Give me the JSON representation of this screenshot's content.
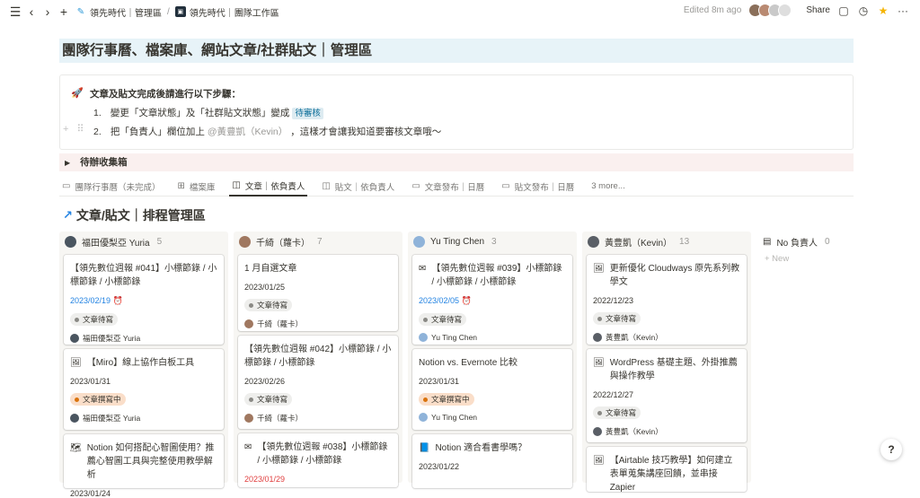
{
  "topbar": {
    "breadcrumb": [
      {
        "label": "領先時代｜管理區",
        "icon": "feather-icon"
      },
      {
        "label": "領先時代｜團隊工作區",
        "icon": "workspace-logo-icon"
      }
    ],
    "edited": "Edited 8m ago",
    "share": "Share",
    "colors": {
      "avatar1": "#8a6f5a",
      "avatar2": "#b98a72",
      "avatar3": "#c9c9c9",
      "avatar4": "#dedede"
    }
  },
  "page": {
    "title": "團隊行事曆、檔案庫、網站文章/社群貼文｜管理區"
  },
  "callout": {
    "icon": "🚀",
    "heading": "文章及貼文完成後請進行以下步驟：",
    "step1_num": "1.",
    "step1_text": "變更「文章狀態」及「社群貼文狀態」變成",
    "step1_tag": "待審核",
    "step2_num": "2.",
    "step2_text": "把「負責人」欄位加上",
    "step2_mention": "@黃豊凱（Kevin）",
    "step2_tail": "，這樣才會讓我知道要審核文章哦～"
  },
  "toggle": {
    "label": "待辦收集箱"
  },
  "tabs": [
    {
      "label": "團隊行事曆（未完成）",
      "icon": "calendar-icon",
      "glyph": "▭"
    },
    {
      "label": "檔案庫",
      "icon": "table-icon",
      "glyph": "⊞"
    },
    {
      "label": "文章｜依負責人",
      "icon": "board-icon",
      "glyph": "◫"
    },
    {
      "label": "貼文｜依負責人",
      "icon": "board-icon",
      "glyph": "◫"
    },
    {
      "label": "文章發布｜日曆",
      "icon": "calendar-icon",
      "glyph": "▭"
    },
    {
      "label": "貼文發布｜日曆",
      "icon": "calendar-icon",
      "glyph": "▭"
    },
    {
      "label": "3 more...",
      "icon": "",
      "glyph": ""
    }
  ],
  "board": {
    "title": "文章/貼文｜排程管理區",
    "columns": [
      {
        "name": "福田優梨亞 Yuria",
        "count": "5",
        "avatar_color": "#4a5560",
        "cards": [
          {
            "title": "【領先數位週報 #041】小標節錄 / 小標節錄 / 小標節錄",
            "date": "2023/02/19",
            "status": "文章待寫",
            "owner": "福田優梨亞 Yuria"
          },
          {
            "title": "【Miro】線上協作白板工具",
            "date": "2023/01/31",
            "status": "文章撰寫中",
            "owner": "福田優梨亞 Yuria"
          },
          {
            "title": "Notion 如何搭配心智圖使用？推薦心智圖工具與完整使用教學解析",
            "date": "2023/01/24"
          }
        ]
      },
      {
        "name": "千綺（蘿卡）",
        "count": "7",
        "avatar_color": "#a07860",
        "cards": [
          {
            "title": "1 月自選文章",
            "date": "2023/01/25",
            "status": "文章待寫",
            "owner": "千綺（蘿卡）"
          },
          {
            "title": "【領先數位週報 #042】小標節錄 / 小標節錄 / 小標節錄",
            "date": "2023/02/26",
            "status": "文章待寫",
            "owner": "千綺（蘿卡）"
          },
          {
            "title": "【領先數位週報 #038】小標節錄 / 小標節錄 / 小標節錄",
            "date": "2023/01/29"
          }
        ]
      },
      {
        "name": "Yu Ting Chen",
        "count": "3",
        "avatar_color": "#8fb3d9",
        "cards": [
          {
            "title": "【領先數位週報 #039】小標節錄 / 小標節錄 / 小標節錄",
            "date": "2023/02/05",
            "status": "文章待寫",
            "owner": "Yu Ting Chen"
          },
          {
            "title": "Notion vs. Evernote 比較",
            "date": "2023/01/31",
            "status": "文章撰寫中",
            "owner": "Yu Ting Chen"
          },
          {
            "title": "Notion 適合看書學嗎？",
            "date": "2023/01/22"
          }
        ]
      },
      {
        "name": "黃豊凱（Kevin）",
        "count": "13",
        "avatar_color": "#5a5f66",
        "cards": [
          {
            "title": "更新優化 Cloudways 原先系列教學文",
            "date": "2022/12/23",
            "status": "文章待寫",
            "owner": "黃豊凱（Kevin）"
          },
          {
            "title": "WordPress 基礎主題、外掛推薦與操作教學",
            "date": "2022/12/27",
            "status": "文章待寫",
            "owner": "黃豊凱（Kevin）"
          },
          {
            "title": "【Airtable 技巧教學】如何建立表單蒐集講座回饋，並串接 Zapier"
          }
        ]
      }
    ],
    "no_owner": {
      "name": "No 負責人",
      "count": "0",
      "new_label": "+ New"
    }
  },
  "help": {
    "label": "?"
  }
}
